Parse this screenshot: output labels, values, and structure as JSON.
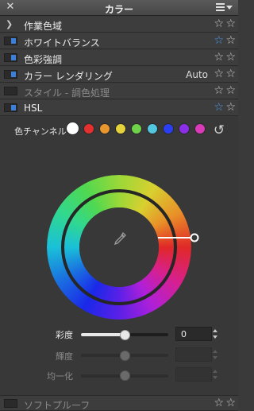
{
  "window": {
    "title": "カラー"
  },
  "sections": [
    {
      "label": "作業色域",
      "kind": "chevron",
      "favorite": false
    },
    {
      "label": "ホワイトバランス",
      "kind": "checkbox",
      "checked": true,
      "favorite": true
    },
    {
      "label": "色彩強調",
      "kind": "checkbox",
      "checked": true,
      "favorite": false
    },
    {
      "label": "カラー レンダリング",
      "kind": "checkbox",
      "checked": true,
      "value": "Auto",
      "favorite": false
    },
    {
      "label": "スタイル - 調色処理",
      "kind": "checkbox",
      "checked": false,
      "disabled": true,
      "favorite": false
    },
    {
      "label": "HSL",
      "kind": "checkbox",
      "checked": true,
      "favorite": true
    }
  ],
  "hsl": {
    "channel_label": "色チャンネル",
    "channels": [
      {
        "name": "white",
        "color": "#ffffff",
        "selected": true
      },
      {
        "name": "red",
        "color": "#e53030"
      },
      {
        "name": "orange",
        "color": "#e8962e"
      },
      {
        "name": "yellow",
        "color": "#e6d23a"
      },
      {
        "name": "green",
        "color": "#6ed24a"
      },
      {
        "name": "cyan",
        "color": "#52c8e0"
      },
      {
        "name": "blue",
        "color": "#2a3ff0"
      },
      {
        "name": "purple",
        "color": "#8a2ee8"
      },
      {
        "name": "magenta",
        "color": "#d93ab8"
      }
    ],
    "sliders": [
      {
        "label": "彩度",
        "value": "0",
        "level": 0.5,
        "enabled": true
      },
      {
        "label": "輝度",
        "value": "",
        "level": 0.5,
        "enabled": false
      },
      {
        "label": "均一化",
        "value": "",
        "level": 0.5,
        "enabled": false
      }
    ]
  },
  "bottom": {
    "label": "ソフトプルーフ",
    "favorite": false
  },
  "colors": {
    "accent": "#3d7fd6",
    "star_active": "#4d9bf0",
    "panel_bg": "#383838"
  },
  "icons": {
    "close": "close-icon",
    "menu": "menu-icon",
    "star": "star-icon",
    "reset": "reset-icon",
    "eyedropper": "eyedropper-icon"
  }
}
